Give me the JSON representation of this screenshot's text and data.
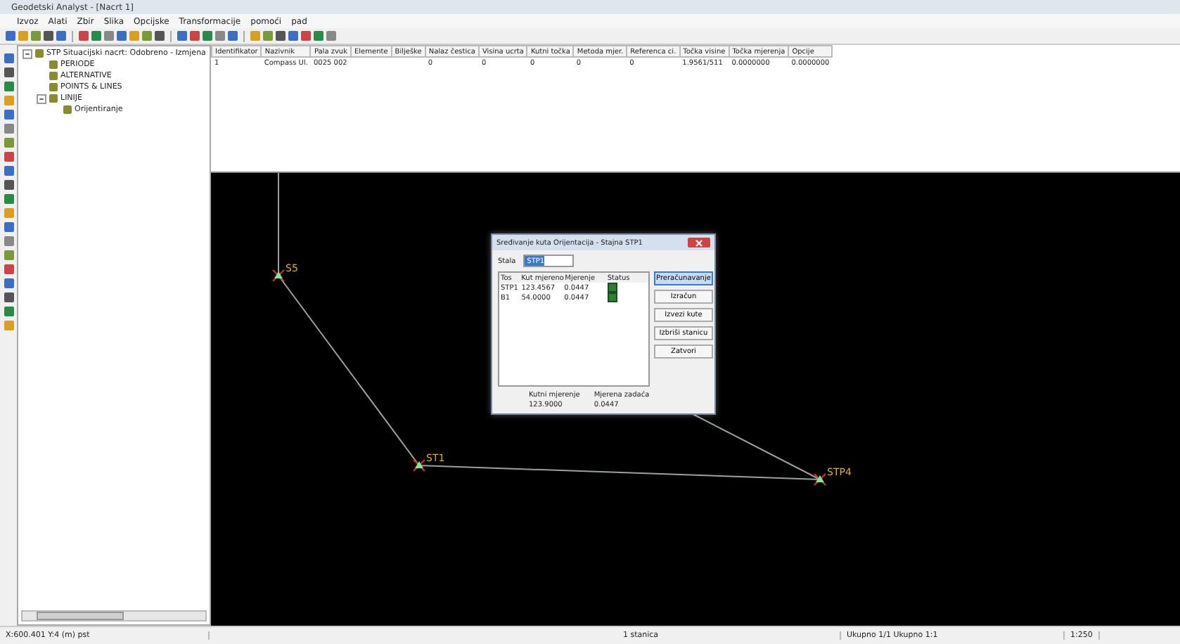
{
  "window": {
    "title": "Geodetski Analyst - [Nacrt 1]"
  },
  "menu": [
    "Izvoz",
    "Alati",
    "Zbir",
    "Slika",
    "Opcijske",
    "Transformacije",
    "pomoći",
    "pad"
  ],
  "tree": [
    {
      "label": "STP Situacijski nacrt: Odobreno - Izmjena",
      "expanded": true,
      "children": [
        {
          "label": "PERIODE"
        },
        {
          "label": "ALTERNATIVE"
        },
        {
          "label": "POINTS & LINES"
        },
        {
          "label": "LINIJE",
          "expanded": true,
          "children": [
            {
              "label": "Orijentiranje"
            }
          ]
        }
      ]
    }
  ],
  "table": {
    "columns": [
      "Identifikator",
      "Nazivnik",
      "Pala zvuk",
      "Elemente",
      "Bilješke",
      "Nalaz čestica",
      "Visina ucrta",
      "Kutni točka",
      "Metoda mjer.",
      "Referenca ci.",
      "Točka visine",
      "Točka mjerenja",
      "Opcije"
    ],
    "rows": [
      [
        "1",
        "Compass Ul.",
        "0025 002",
        "",
        "",
        "0",
        "0",
        "0",
        "0",
        "0",
        "1.9561/511",
        "0.0000000",
        "0.0000000"
      ]
    ]
  },
  "stations": [
    {
      "label": "S5"
    },
    {
      "label": "ST1"
    },
    {
      "label": "STP4"
    }
  ],
  "dialog": {
    "title": "Sređivanje kuta Orijentacija - Stajna STP1",
    "field_label": "Stala",
    "field_value": "STP1",
    "columns": [
      "Tos",
      "Kut mjereno",
      "Mjerenje",
      "Status"
    ],
    "rows": [
      {
        "cells": [
          "STP1",
          "123.4567",
          "0.0447"
        ],
        "checked": true
      },
      {
        "cells": [
          "B1",
          "54.0000",
          "0.0447"
        ],
        "checked": true
      }
    ],
    "buttons": [
      {
        "label": "Preračunavanje",
        "default": true
      },
      {
        "label": "Izračun",
        "default": false
      },
      {
        "label": "Izvezi kute",
        "default": false
      },
      {
        "label": "Izbriši stanicu",
        "default": false
      },
      {
        "label": "Zatvori",
        "default": false
      }
    ],
    "summary": [
      {
        "label": "Kutni mjerenje",
        "value": "123.9000"
      },
      {
        "label": "Mjerena zadaća",
        "value": "0.0447"
      }
    ]
  },
  "status_bar": [
    "X:600.401 Y:4 (m) pst",
    "1 stanica",
    "Ukupno 1/1 Ukupno 1:1",
    "1:250"
  ]
}
